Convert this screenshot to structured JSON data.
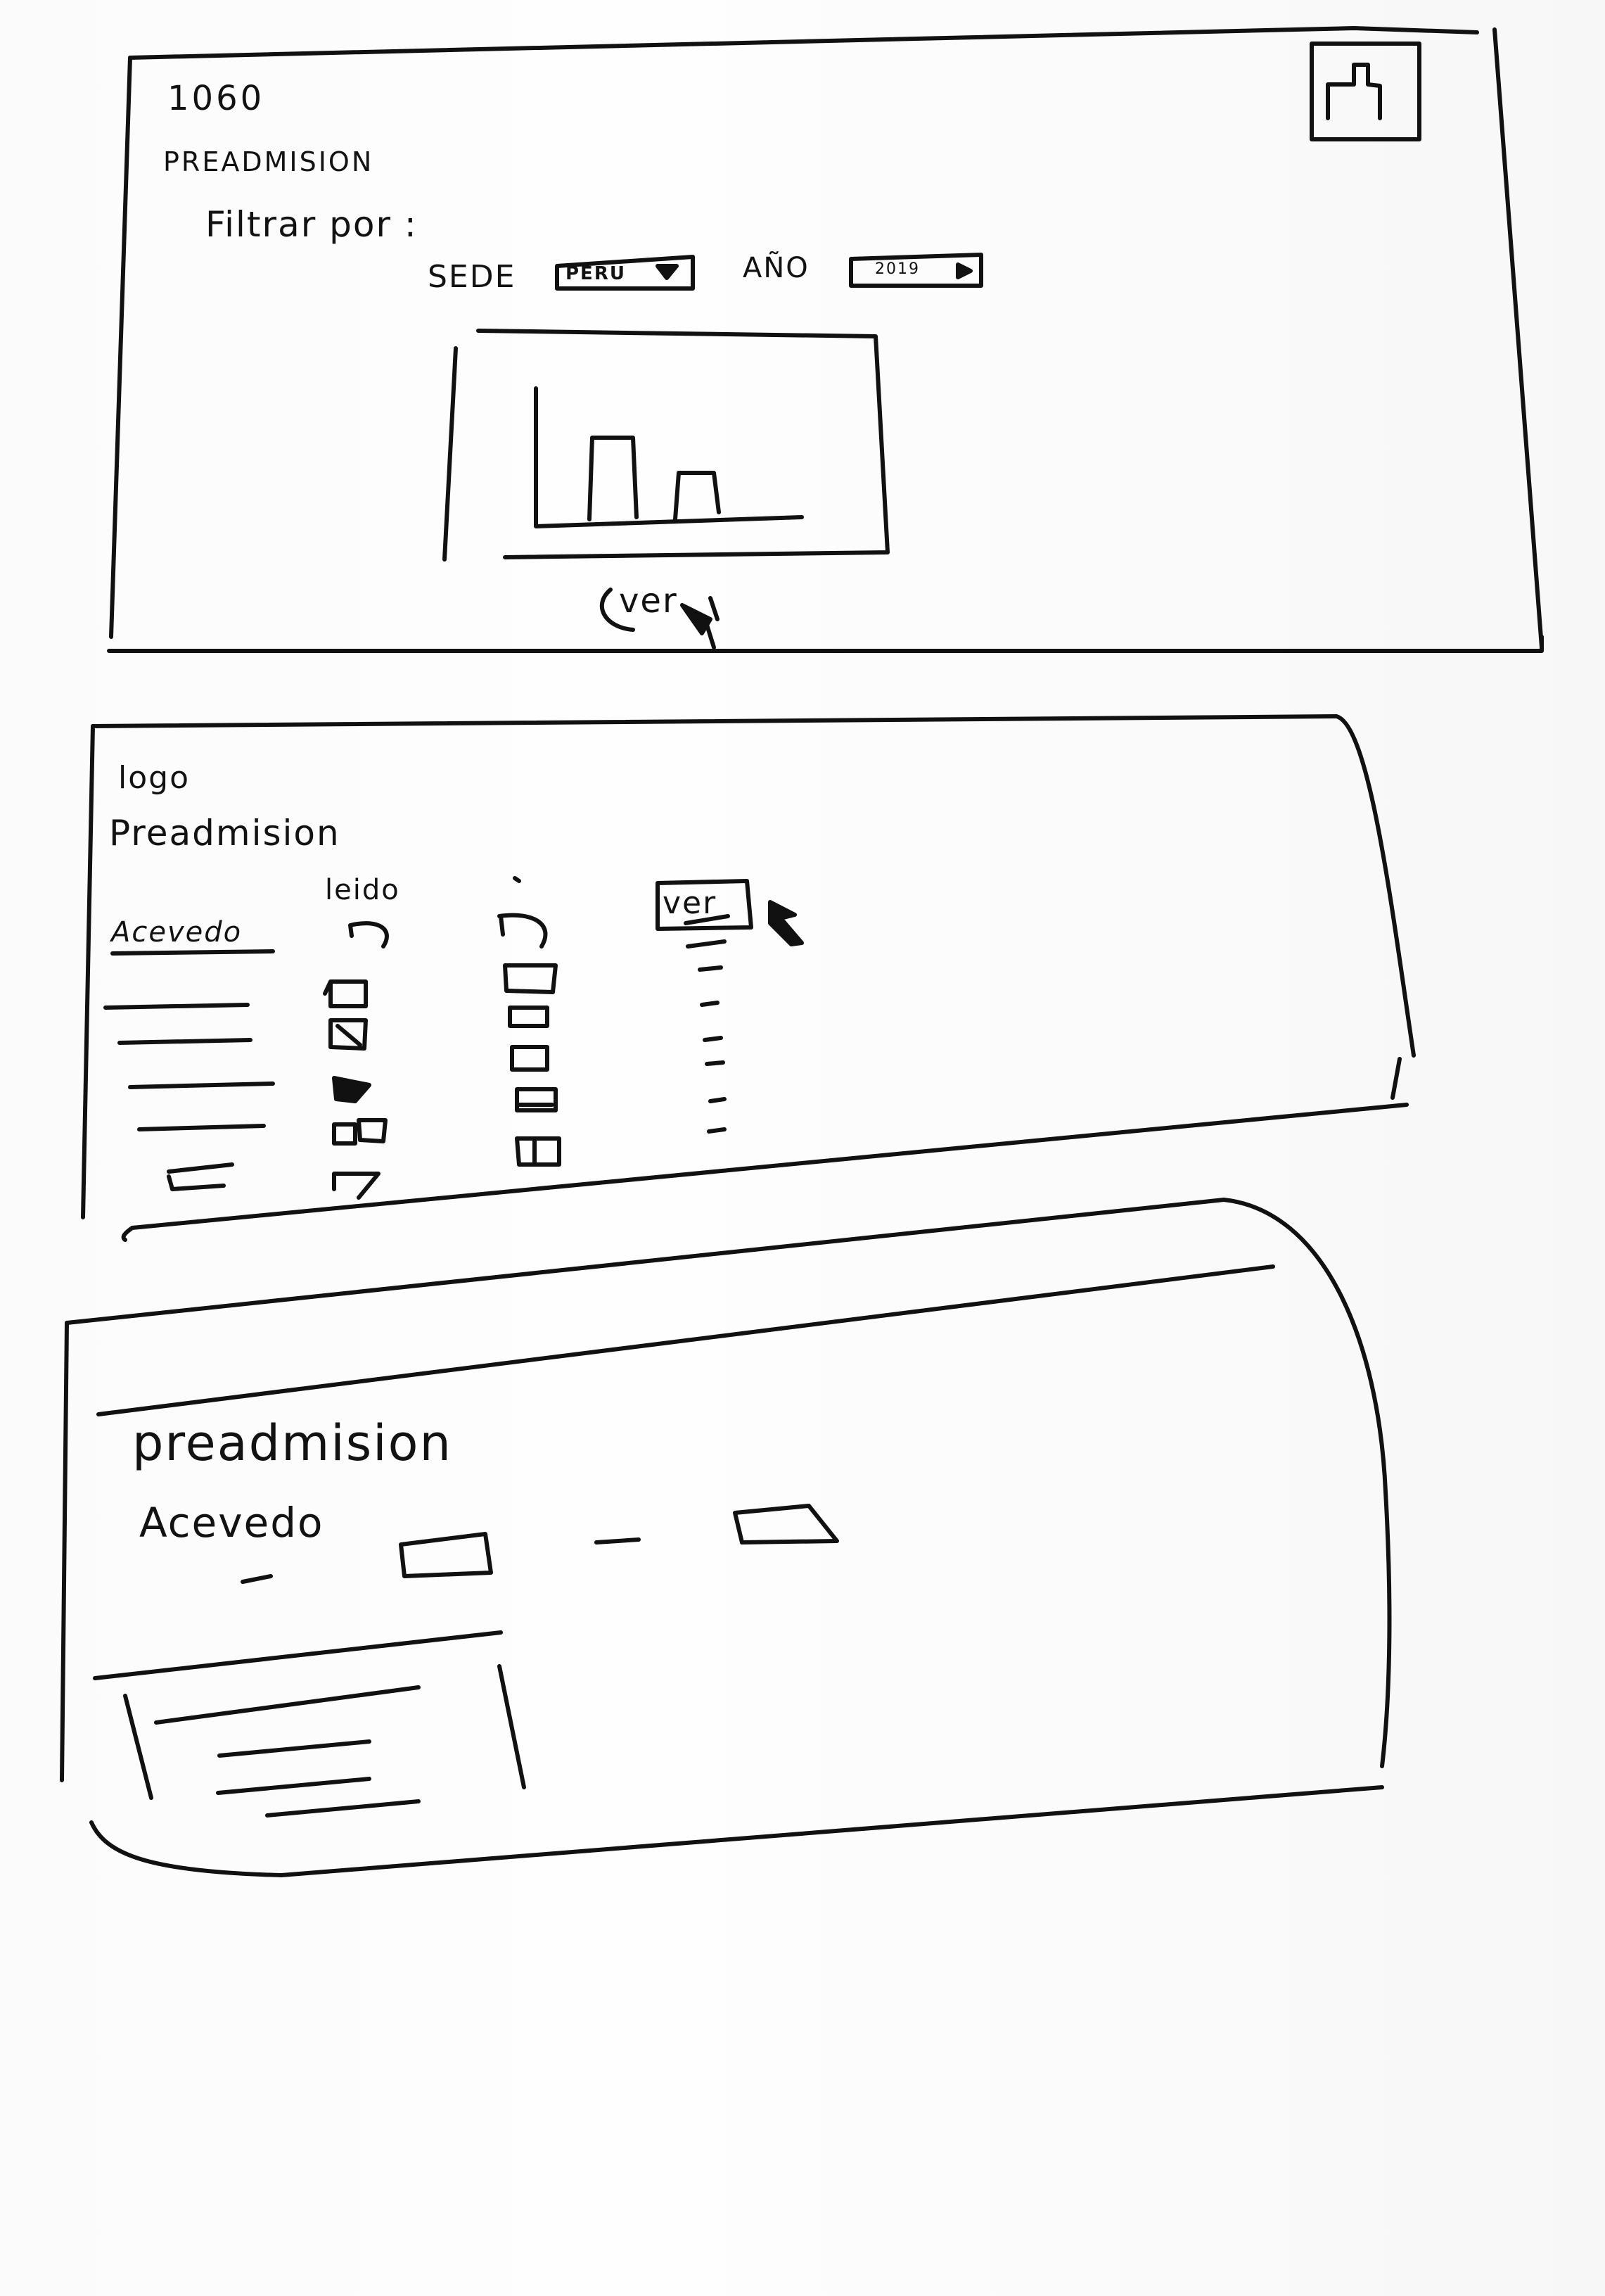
{
  "screens": [
    {
      "logo": "1060",
      "heading": "PREADMISION",
      "filter_label": "Filtrar por :",
      "sede_label": "SEDE",
      "sede_value": "PERU",
      "ano_label": "AÑO",
      "ano_value": "2019",
      "view_button": "ver"
    },
    {
      "logo": "logo",
      "heading": "Preadmision",
      "column_header_read": "leido",
      "column_header_second": "-",
      "view_button": "ver",
      "first_row_name": "Acevedo"
    },
    {
      "heading": "preadmision",
      "name": "Acevedo"
    }
  ]
}
